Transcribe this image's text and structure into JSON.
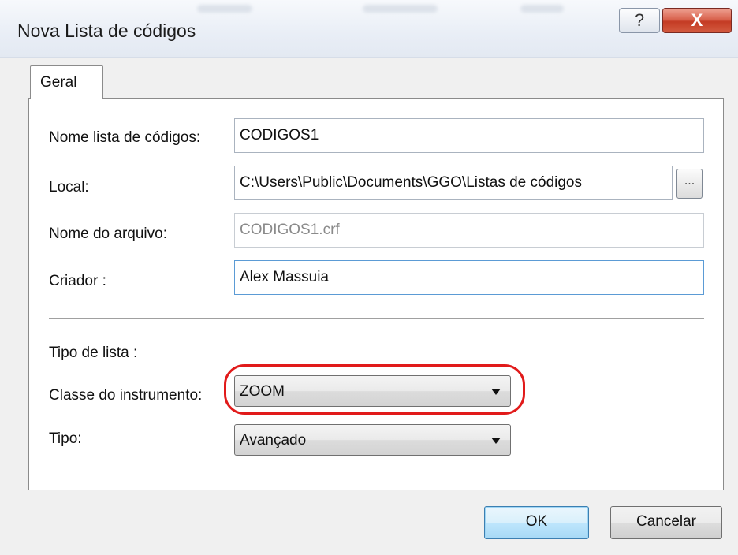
{
  "window": {
    "title": "Nova Lista de códigos",
    "help_label": "?",
    "close_label": "X"
  },
  "tabs": [
    {
      "label": "Geral",
      "active": true
    }
  ],
  "form": {
    "nome_lista": {
      "label": "Nome lista de códigos:",
      "value": "CODIGOS1"
    },
    "local": {
      "label": "Local:",
      "value": "C:\\Users\\Public\\Documents\\GGO\\Listas de códigos",
      "browse_label": "..."
    },
    "nome_arquivo": {
      "label": "Nome do arquivo:",
      "value": "CODIGOS1.crf",
      "disabled": true
    },
    "criador": {
      "label": "Criador :",
      "value": "Alex Massuia"
    },
    "tipo_lista_label": "Tipo de lista :",
    "classe": {
      "label": "Classe do instrumento:",
      "value": "ZOOM"
    },
    "tipo": {
      "label": "Tipo:",
      "value": "Avançado"
    }
  },
  "buttons": {
    "ok": "OK",
    "cancel": "Cancelar"
  },
  "colors": {
    "highlight": "#e11a1a",
    "close_button": "#c43b24",
    "focus_border": "#5b9bd5"
  }
}
